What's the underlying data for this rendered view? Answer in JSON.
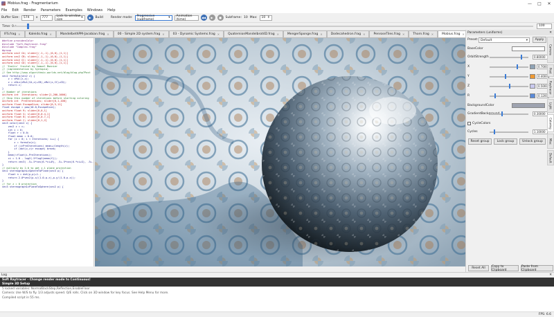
{
  "window": {
    "title": "Mobius.frag - Fragmentarium",
    "minimize": "—",
    "maximize": "□",
    "close": "✕"
  },
  "menu": [
    "File",
    "Edit",
    "Render",
    "Parameters",
    "Examples",
    "Windows",
    "Help"
  ],
  "toolbar": {
    "buffer_label": "Buffer Size:",
    "buffer_x": "574",
    "buffer_sep": "x",
    "buffer_y": "777",
    "lock_mode": "Lock to window size",
    "build_label": "Build",
    "render_mode_label": "Render mode:",
    "render_mode": "Progressive (subframe)",
    "animation_label": "Animation (time)",
    "subframe_label": "Subframe:",
    "subframe_value": "10",
    "max_label": "Max:",
    "max_value": "10"
  },
  "timebar": {
    "label": "Time: 0 s",
    "end_value": "100"
  },
  "tabs": [
    {
      "label": "IFS.frag"
    },
    {
      "label": "Kaleido.frag"
    },
    {
      "label": "MandelbethPM-Jacobian.frag"
    },
    {
      "label": "00 - Simple 2D system.frag"
    },
    {
      "label": "03 - Dynamic Systems.frag"
    },
    {
      "label": "QuaternionMandelbrot4D.frag"
    },
    {
      "label": "MengerSponge.frag"
    },
    {
      "label": "Dodecahedron.frag"
    },
    {
      "label": "PenroseTiles.frag"
    },
    {
      "label": "Thorn.frag"
    },
    {
      "label": "Mobius.frag",
      "active": true
    }
  ],
  "code": [
    {
      "t": "#define providesColor",
      "c": "kw"
    },
    {
      "t": "#include \"Soft-Raytracer.frag\"",
      "c": "kw"
    },
    {
      "t": "",
      "c": ""
    },
    {
      "t": "",
      "c": ""
    },
    {
      "t": "#include \"Complex.frag\"",
      "c": "kw"
    },
    {
      "t": "#group",
      "c": "kw"
    },
    {
      "t": "uniform vec2 CA; slider[(-1,-1),(0,0),(1,1)]",
      "c": "pl"
    },
    {
      "t": "uniform vec2 CB; slider[(-1,-1),(0,0),(1,1)]",
      "c": "pl"
    },
    {
      "t": "uniform vec2 CC; slider[(-1,-1),(0,0),(1,1)]",
      "c": "pl"
    },
    {
      "t": "uniform vec2 CD; slider[(-1,-1),(0,0),(1,1)]",
      "c": "pl"
    },
    {
      "t": "// 'Exotic' fractal by Samuel Monnier",
      "c": "cm"
    },
    {
      "t": "// (implementation by Syntopia)",
      "c": "cm"
    },
    {
      "t": "// See http://www.algorithmic-worlds.net/blog/blog.php?Post",
      "c": "cm"
    },
    {
      "t": "vec2 formula(vec2 z) {",
      "c": ""
    },
    {
      "t": "    z = cMul(z,z);",
      "c": ""
    },
    {
      "t": "    z = cDiv(cMul(CA,z)+CB),cMul(z,CC)+CD);",
      "c": ""
    },
    {
      "t": "    return z;",
      "c": ""
    },
    {
      "t": "}",
      "c": ""
    },
    {
      "t": "",
      "c": ""
    },
    {
      "t": "// Number of iterations",
      "c": "cm"
    },
    {
      "t": "uniform int  Iterations; slider[1,200,1000]",
      "c": "pl"
    },
    {
      "t": "",
      "c": ""
    },
    {
      "t": "",
      "c": ""
    },
    {
      "t": "// Skip this number of iterations before starting coloring",
      "c": "cm"
    },
    {
      "t": "uniform int  PreIterations; slider[0,1,100]",
      "c": "pl"
    },
    {
      "t": "uniform float EscapeSize; slider[0,5,11]",
      "c": "pl"
    },
    {
      "t": "float escape = pow(10.0,EscapeSize);",
      "c": ""
    },
    {
      "t": "",
      "c": ""
    },
    {
      "t": "uniform float R; slider[0,0,1]",
      "c": "pl"
    },
    {
      "t": "uniform float G; slider[0,0.4,1]",
      "c": "pl"
    },
    {
      "t": "uniform float B; slider[0,0.7,1]",
      "c": "pl"
    },
    {
      "t": "uniform float C; slider[0,1,2]",
      "c": "pl"
    },
    {
      "t": "",
      "c": ""
    },
    {
      "t": "vec3 color(vec2 c) {",
      "c": ""
    },
    {
      "t": "    vec2 z = c;",
      "c": ""
    },
    {
      "t": "    int i = 0;",
      "c": ""
    },
    {
      "t": "    float r = 0.0;",
      "c": ""
    },
    {
      "t": "    float mean = 0.0;",
      "c": ""
    },
    {
      "t": "    for (i = 0; i < Iterations; i++) {",
      "c": ""
    },
    {
      "t": "        z = formula(z);",
      "c": ""
    },
    {
      "t": "        if (i>PreIterations) mean+=length(z);",
      "c": ""
    },
    {
      "t": "        if (dot(z,z)> escape) break;",
      "c": ""
    },
    {
      "t": "    }",
      "c": ""
    },
    {
      "t": "    mean/=float(i-PreIterations);",
      "c": ""
    },
    {
      "t": "    ci = 1.0 - log2(.5*log2(mean/C));",
      "c": ""
    },
    {
      "t": "    return vec3( .5+.5*cos(6.*ci+R), .5+.5*cos(6.*ci+G), .5+.5*cos(6.*ci+B));",
      "c": ""
    },
    {
      "t": "}",
      "c": ""
    },
    {
      "t": "",
      "c": ""
    },
    {
      "t": "",
      "c": ""
    },
    {
      "t": "",
      "c": ""
    },
    {
      "t": "// multiply by 2.0 to get z-1 plane projection",
      "c": "cm"
    },
    {
      "t": "vec2 stereographicSphereToPlane(vec3 p) {",
      "c": ""
    },
    {
      "t": "    float n = dot(p,p)+1.;",
      "c": ""
    },
    {
      "t": "    return 2.0*vec2(p.x/(1.0-p.z),p.y/(1.0-p.z));",
      "c": ""
    },
    {
      "t": "}",
      "c": ""
    },
    {
      "t": "",
      "c": ""
    },
    {
      "t": "// for z = 0 projection",
      "c": "cm"
    },
    {
      "t": "vec3 stereographicPlaneToSphere(vec2 p) {",
      "c": ""
    }
  ],
  "panel": {
    "title": "Parameters (uniforms)",
    "preset_label": "Preset:",
    "preset_value": "Default",
    "apply_label": "Apply",
    "params": [
      {
        "name": "BaseColor",
        "kind": "color_wide"
      },
      {
        "name": "OrbitStrength",
        "kind": "slider",
        "value": "0.80000",
        "pos": 0.8
      },
      {
        "name": "X",
        "kind": "slider_swatch",
        "value": "0.70000",
        "pos": 0.7,
        "color": "#8fa3b5"
      },
      {
        "name": "Y",
        "kind": "slider_swatch",
        "value": "0.40000",
        "pos": 0.4,
        "color": "#ee9933"
      },
      {
        "name": "Z",
        "kind": "slider_swatch",
        "value": "0.50000",
        "pos": 0.5,
        "color": "#c9c9ee"
      },
      {
        "name": "R",
        "kind": "slider_swatch",
        "value": "0.12000",
        "pos": 0.12,
        "color": "#5a8ad8"
      },
      {
        "name": "BackgroundColor",
        "kind": "color_wide"
      },
      {
        "name": "GradientBackground",
        "kind": "slider",
        "value": "0.30000",
        "pos": 0.3
      },
      {
        "name": "CycleColors",
        "kind": "check"
      },
      {
        "name": "Cycles",
        "kind": "slider",
        "value": "1.10000",
        "pos": 0.11
      }
    ],
    "buttons": [
      "Reset group",
      "Lock group",
      "Unlock group"
    ],
    "bottom_buttons": [
      "Reset All",
      "Copy to Clipboard",
      "Paste from Clipboard"
    ],
    "vtabs": [
      "Camera",
      "Post",
      "Raytracer",
      "Light",
      "Coloring",
      "Misc",
      "Default"
    ]
  },
  "log": {
    "title": "Log",
    "lines": [
      {
        "t": "Soft Raytracer - Change render mode to Continuous!",
        "c": "dark"
      },
      {
        "t": "Simple 3D Setup",
        "c": "dark"
      },
      {
        "t": "5 locked variables: NormalBackStep,Reflection,EnableFloor",
        "c": "norm"
      },
      {
        "t": "Camera: Use W/S to fly. 1/3 adjusts speed. Q/E rolls. Click on 3D window for key focus. See Help Menu for more.",
        "c": "norm"
      },
      {
        "t": "Compiled script in 55 ms.",
        "c": "norm"
      }
    ]
  },
  "status": "FPS: 6.6"
}
